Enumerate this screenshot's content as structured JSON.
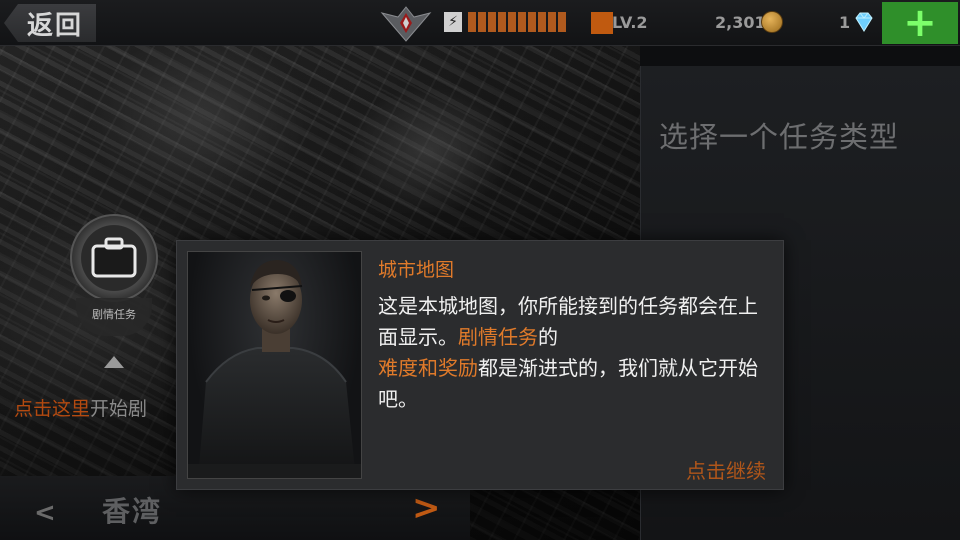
{
  "topbar": {
    "back_label": "返回",
    "level": "LV.2",
    "coins": "2,301",
    "gems": "1",
    "energy_segments_filled": 10,
    "energy_segments_total": 10,
    "icons": [
      "rank-emblem-icon",
      "energy-icon",
      "level-icon",
      "coin-icon",
      "diamond-icon",
      "plus-icon"
    ],
    "colors": {
      "accent": "#c05a10",
      "add_button": "#2f8f2a",
      "plus": "#7cff6a"
    }
  },
  "right_panel": {
    "heading": "选择一个任务类型"
  },
  "map": {
    "pin_label": "剧情任务",
    "pin_icon": "briefcase-icon",
    "hint_highlight": "点击这里",
    "hint_rest": "开始剧"
  },
  "region": {
    "name": "香湾",
    "left_arrow": "<",
    "right_arrow": ">"
  },
  "dialog": {
    "title": "城市地图",
    "body_part1": "这是本城地图，你所能接到的任务都会在上面显示。",
    "body_highlight1": "剧情任务",
    "body_part2": "的",
    "body_highlight2": "难度和奖励",
    "body_part3": "都是渐进式的，我们就从它开始吧。",
    "continue_label": "点击继续",
    "colors": {
      "highlight": "#e07a2a"
    }
  }
}
